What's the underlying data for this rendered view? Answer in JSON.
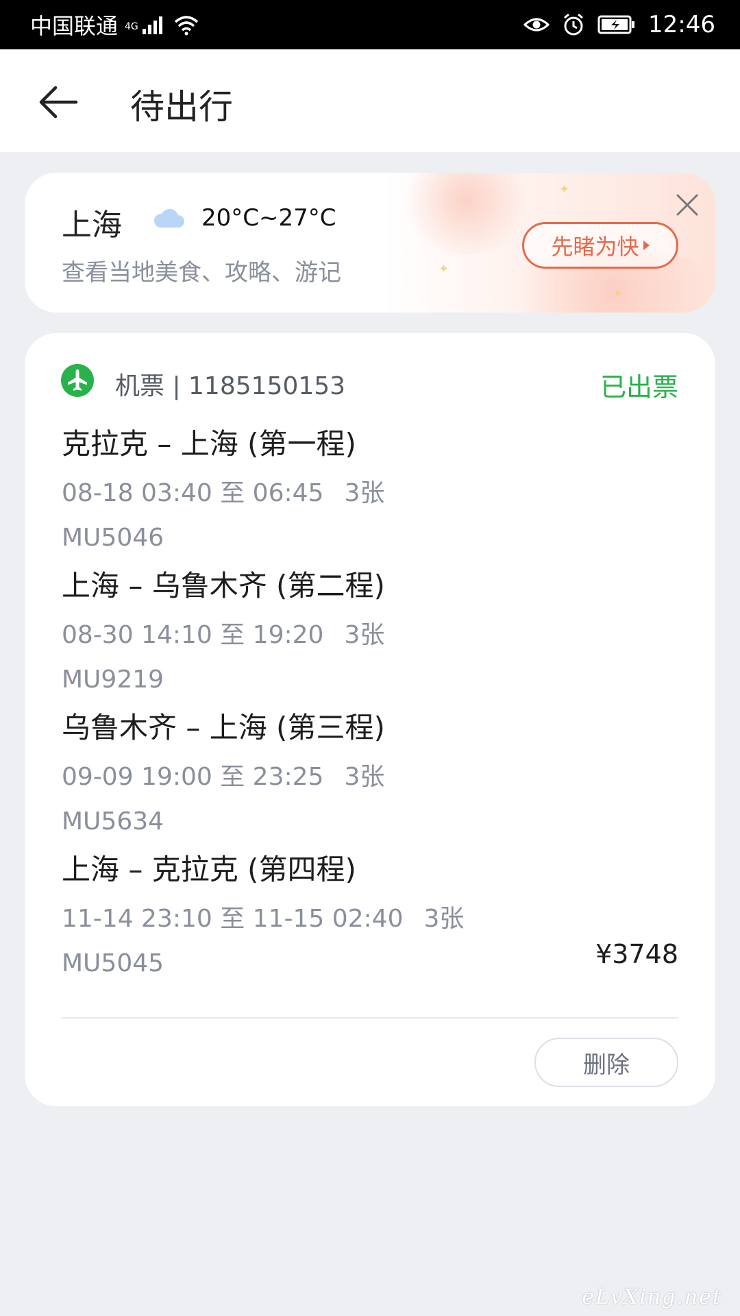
{
  "status_bar": {
    "carrier": "中国联通",
    "network": "4G",
    "time": "12:46"
  },
  "header": {
    "back_icon": "arrow-left-icon",
    "title": "待出行"
  },
  "promo": {
    "city": "上海",
    "weather_icon": "cloud-icon",
    "temperature": "20°C~27°C",
    "subtitle": "查看当地美食、攻略、游记",
    "button_label": "先睹为快",
    "close_icon": "close-icon",
    "accent_color": "#e6694a"
  },
  "order": {
    "type_icon": "plane-icon",
    "type_label": "机票 | 1185150153",
    "status": "已出票",
    "status_color": "#27b24a",
    "legs": [
      {
        "route": "克拉克 – 上海 (第一程)",
        "time": "08-18 03:40 至 06:45",
        "tickets": "3张",
        "flight": "MU5046"
      },
      {
        "route": "上海 – 乌鲁木齐 (第二程)",
        "time": "08-30 14:10 至 19:20",
        "tickets": "3张",
        "flight": "MU9219"
      },
      {
        "route": "乌鲁木齐 – 上海 (第三程)",
        "time": "09-09 19:00 至 23:25",
        "tickets": "3张",
        "flight": "MU5634"
      },
      {
        "route": "上海 – 克拉克 (第四程)",
        "time": "11-14 23:10 至 11-15 02:40",
        "tickets": "3张",
        "flight": "MU5045"
      }
    ],
    "price": "¥3748",
    "delete_label": "删除"
  },
  "watermark": "eLvXing.net"
}
